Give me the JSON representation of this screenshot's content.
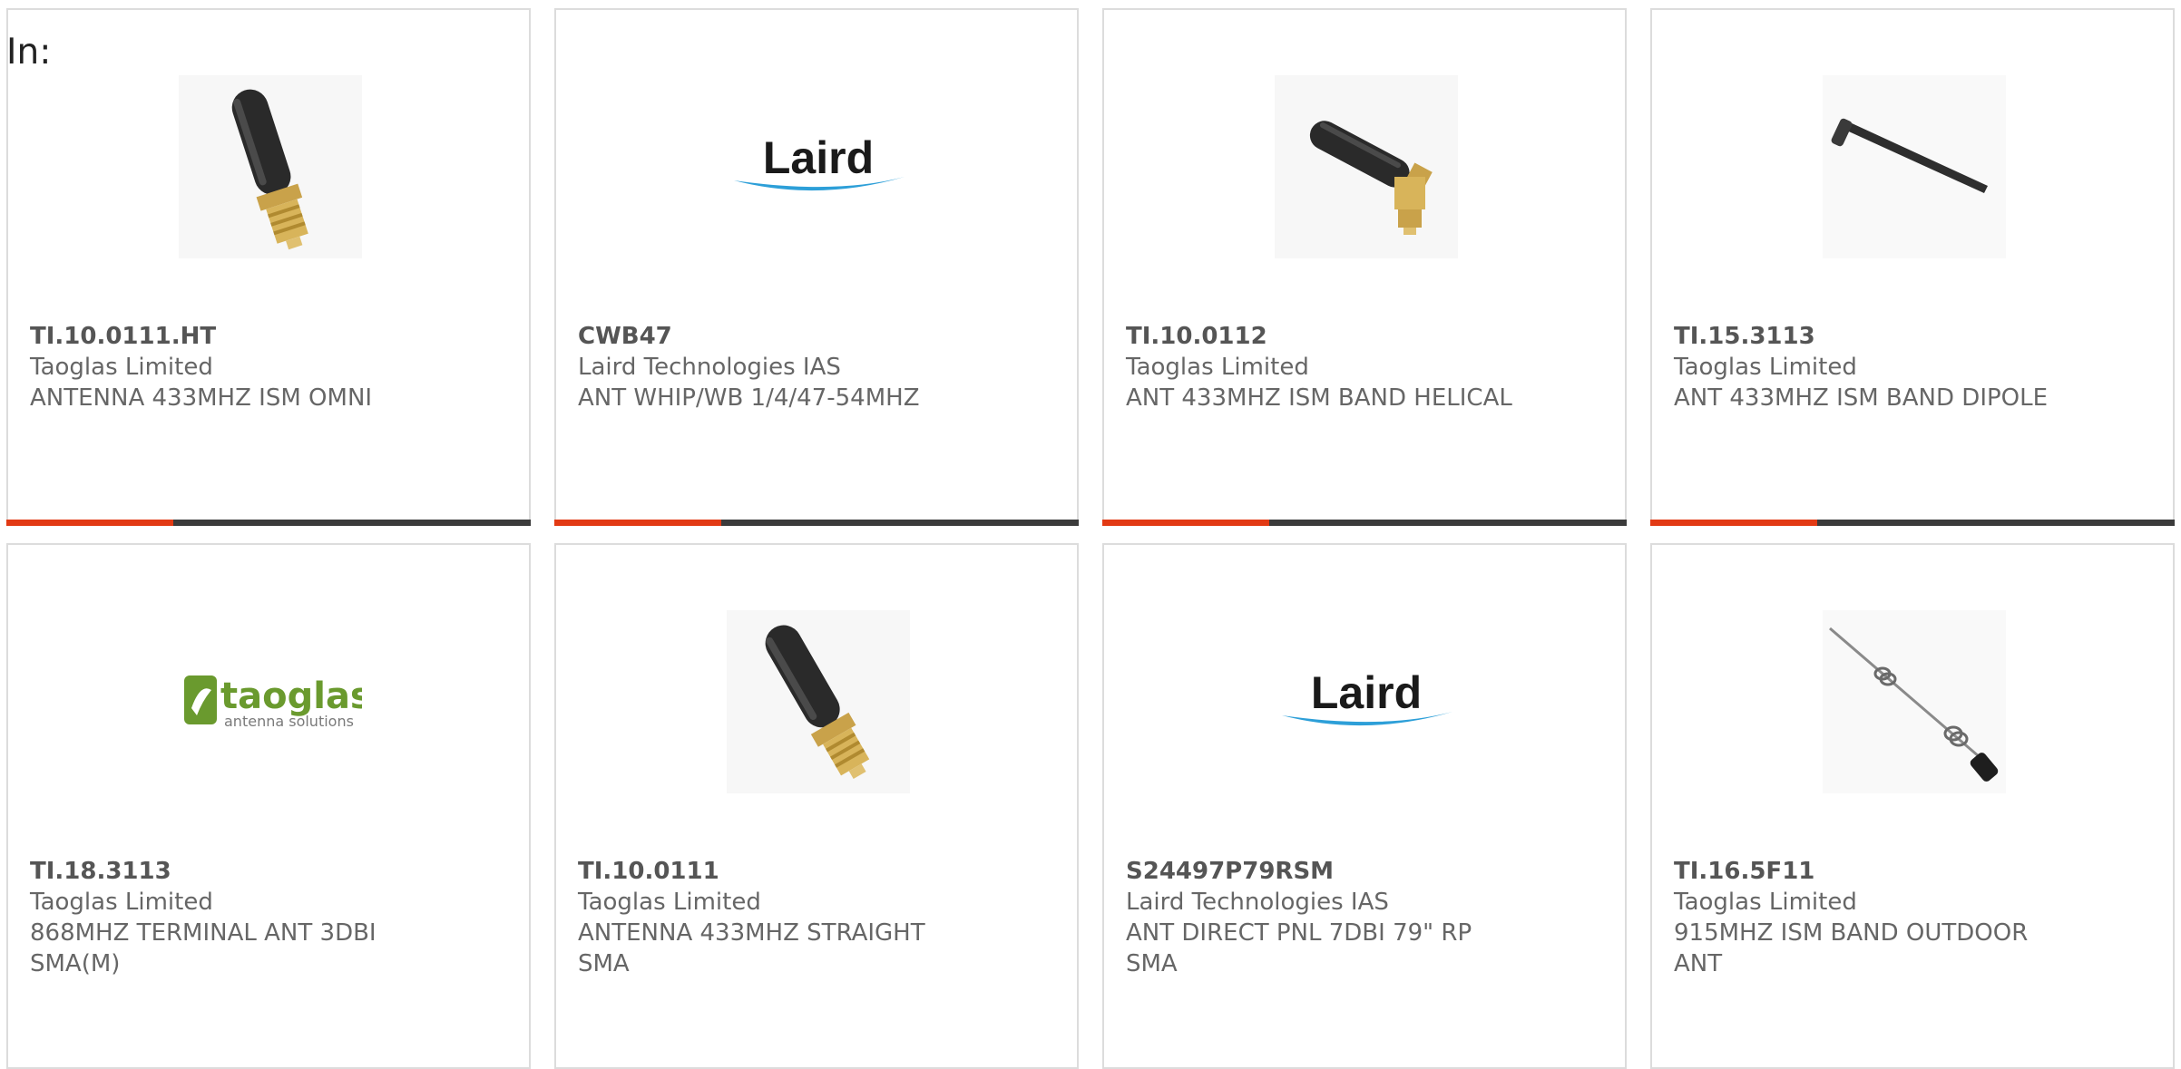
{
  "page": {
    "in_label": "In:"
  },
  "accent_color": "#e23a14",
  "bar_color": "#3b3b3b",
  "cards": [
    {
      "part": "TI.10.0111.HT",
      "maker": "Taoglas Limited",
      "desc": "ANTENNA 433MHZ ISM OMNI",
      "image": "stubby-antenna-straight"
    },
    {
      "part": "CWB47",
      "maker": "Laird Technologies IAS",
      "desc": "ANT WHIP/WB 1/4/47-54MHZ",
      "image": "laird-logo",
      "logo_text": "Laird"
    },
    {
      "part": "TI.10.0112",
      "maker": "Taoglas Limited",
      "desc": "ANT 433MHZ ISM BAND HELICAL",
      "image": "stubby-antenna-right-angle"
    },
    {
      "part": "TI.15.3113",
      "maker": "Taoglas Limited",
      "desc": "ANT 433MHZ ISM BAND DIPOLE",
      "image": "dipole-antenna-thin"
    },
    {
      "part": "TI.18.3113",
      "maker": "Taoglas Limited",
      "desc": "868MHZ TERMINAL ANT 3DBI SMA(M)",
      "image": "taoglas-logo",
      "logo_text": "taoglas",
      "logo_subtext": "antenna solutions"
    },
    {
      "part": "TI.10.0111",
      "maker": "Taoglas Limited",
      "desc": "ANTENNA 433MHZ STRAIGHT SMA",
      "image": "stubby-antenna-straight"
    },
    {
      "part": "S24497P79RSM",
      "maker": "Laird Technologies IAS",
      "desc": "ANT DIRECT PNL 7DBI 79\" RP SMA",
      "image": "laird-logo",
      "logo_text": "Laird"
    },
    {
      "part": "TI.16.5F11",
      "maker": "Taoglas Limited",
      "desc": "915MHZ ISM BAND OUTDOOR ANT",
      "image": "coil-whip-antenna"
    }
  ]
}
